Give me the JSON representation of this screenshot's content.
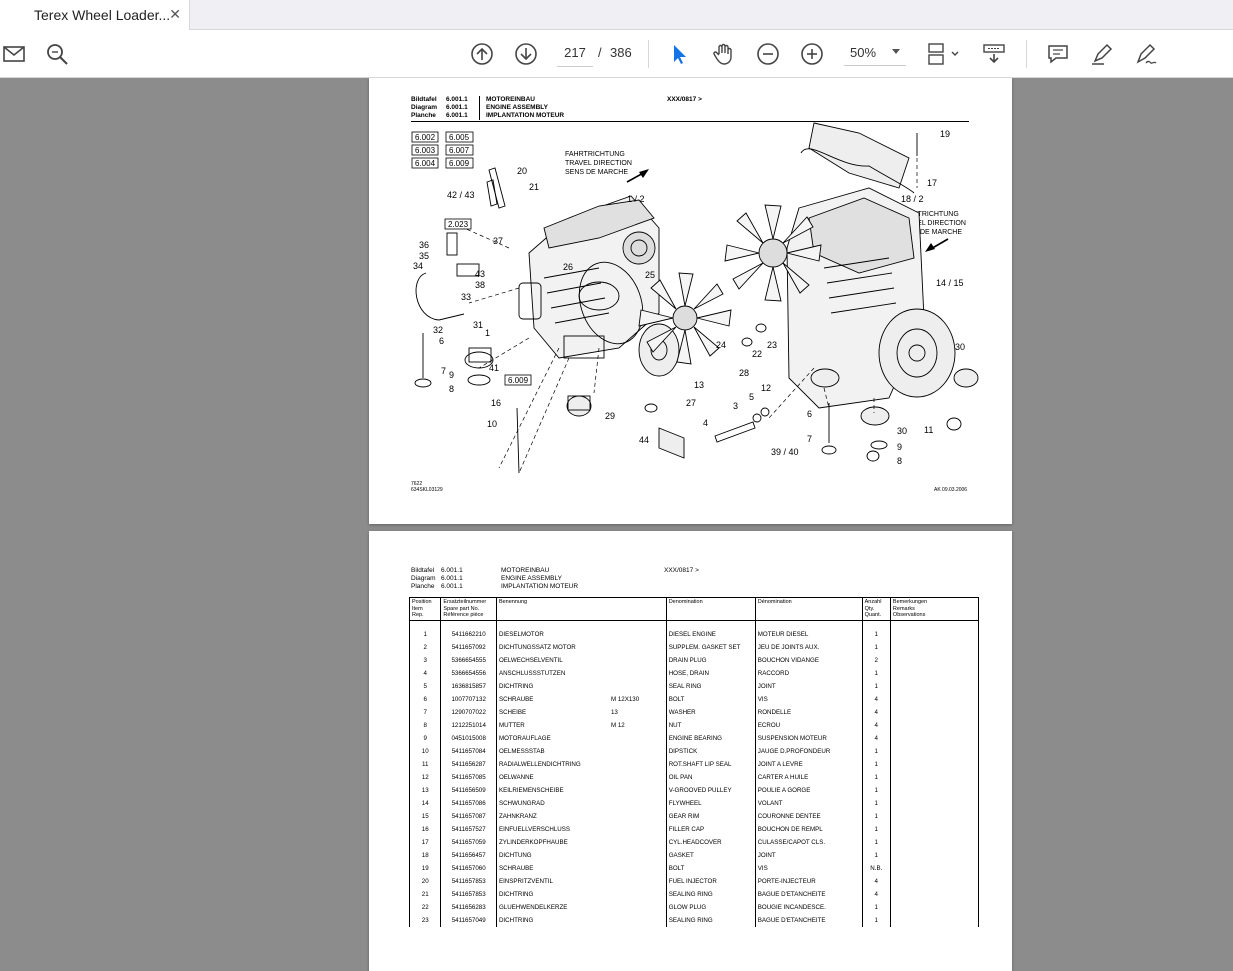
{
  "tab": {
    "title": "Terex Wheel Loader...",
    "close": "✕"
  },
  "toolbar": {
    "page_current": "217",
    "page_separator": "/",
    "page_total": "386",
    "zoom": "50%"
  },
  "page1": {
    "header": {
      "labels": [
        "Bildtafel",
        "Diagram",
        "Planche"
      ],
      "codes": [
        "6.001.1",
        "6.001.1",
        "6.001.1"
      ],
      "titles": [
        "MOTOREINBAU",
        "ENGINE ASSEMBLY",
        "IMPLANTATION MOTEUR"
      ],
      "serial": "XXX/0817 >"
    },
    "refs": [
      "6.002",
      "6.005",
      "6.003",
      "6.007",
      "6.004",
      "6.009"
    ],
    "direction_left": [
      "FAHRTRICHTUNG",
      "TRAVEL DIRECTION",
      "SENS DE MARCHE"
    ],
    "direction_right": [
      "FAHRTRICHTUNG",
      "TRAVEL DIRECTION",
      "SENS DE MARCHE"
    ],
    "callouts_left": [
      "20",
      "21",
      "42 / 43",
      "1 / 2",
      "2.023",
      "37",
      "36",
      "35",
      "34",
      "43",
      "38",
      "26",
      "25",
      "33",
      "31",
      "32",
      "6",
      "1",
      "7",
      "9",
      "8",
      "41",
      "6.009",
      "16",
      "10",
      "29",
      "27",
      "44",
      "24",
      "13"
    ],
    "callouts_right": [
      "19",
      "17",
      "18 / 2",
      "14 / 15",
      "23",
      "22",
      "28",
      "5",
      "12",
      "3",
      "4",
      "30",
      "6",
      "7",
      "39 / 40",
      "30",
      "11",
      "9",
      "8"
    ],
    "footer_left": [
      "7622",
      "634SKL03129"
    ],
    "footer_right": "AK  09.03.2006"
  },
  "page2": {
    "header": {
      "labels": [
        "Bildtafel",
        "Diagram",
        "Planche"
      ],
      "codes": [
        "6.001.1",
        "6.001.1",
        "6.001.1"
      ],
      "titles": [
        "MOTOREINBAU",
        "ENGINE ASSEMBLY",
        "IMPLANTATION MOTEUR"
      ],
      "serial": "XXX/0817 >"
    },
    "columns": {
      "pos": [
        "Position",
        "Item",
        "Rep."
      ],
      "part": [
        "Ersatzteilnummer",
        "Spare part No.",
        "Référence pièce"
      ],
      "benennung": "Benennung",
      "denomination_en": "Denomination",
      "denomination_fr": "Dénomination",
      "qty": [
        "Anzahl",
        "Qty.",
        "Quant."
      ],
      "remarks": [
        "Bemerkungen",
        "Remarks",
        "Observations"
      ]
    },
    "rows": [
      [
        "1",
        "5411662210",
        "DIESELMOTOR",
        "",
        "DIESEL ENGINE",
        "MOTEUR DIESEL",
        "1"
      ],
      [
        "2",
        "5411657092",
        "DICHTUNGSSATZ MOTOR",
        "",
        "SUPPLEM. GASKET SET",
        "JEU DE JOINTS AUX.",
        "1"
      ],
      [
        "3",
        "5366654555",
        "OELWECHSELVENTIL",
        "",
        "DRAIN PLUG",
        "BOUCHON VIDANGE",
        "2"
      ],
      [
        "4",
        "5366654556",
        "ANSCHLUSSSTUTZEN",
        "",
        "HOSE, DRAIN",
        "RACCORD",
        "1"
      ],
      [
        "5",
        "1636815857",
        "DICHTRING",
        "",
        "SEAL RING",
        "JOINT",
        "1"
      ],
      [
        "6",
        "1007707132",
        "SCHRAUBE",
        "M 12X130",
        "BOLT",
        "VIS",
        "4"
      ],
      [
        "7",
        "1290707022",
        "SCHEIBE",
        "13",
        "WASHER",
        "RONDELLE",
        "4"
      ],
      [
        "8",
        "1212251014",
        "MUTTER",
        "M 12",
        "NUT",
        "ECROU",
        "4"
      ],
      [
        "9",
        "0451015008",
        "MOTORAUFLAGE",
        "",
        "ENGINE BEARING",
        "SUSPENSION MOTEUR",
        "4"
      ],
      [
        "10",
        "5411657084",
        "OELMESSSTAB",
        "",
        "DIPSTICK",
        "JAUGE D.PROFONDEUR",
        "1"
      ],
      [
        "11",
        "5411656287",
        "RADIALWELLENDICHTRING",
        "",
        "ROT.SHAFT LIP SEAL",
        "JOINT A LEVRE",
        "1"
      ],
      [
        "12",
        "5411657085",
        "OELWANNE",
        "",
        "OIL PAN",
        " CARTER A HUILE",
        "1"
      ],
      [
        "13",
        "5411656509",
        "KEILRIEMENSCHEIBE",
        "",
        "V-GROOVED PULLEY",
        "POULIE A GORGE",
        "1"
      ],
      [
        "14",
        "5411657086",
        "SCHWUNGRAD",
        "",
        "FLYWHEEL",
        "VOLANT",
        "1"
      ],
      [
        "15",
        "5411657087",
        "ZAHNKRANZ",
        "",
        "GEAR RIM",
        "COURONNE DENTEE",
        "1"
      ],
      [
        "16",
        "5411657527",
        "EINFUELLVERSCHLUSS",
        "",
        "FILLER CAP",
        "BOUCHON DE REMPL",
        "1"
      ],
      [
        "17",
        "5411657059",
        "ZYLINDERKOPFHAUBE",
        "",
        "CYL.HEADCOVER",
        "CULASSE/CAPOT CLS.",
        "1"
      ],
      [
        "18",
        "5411656457",
        "DICHTUNG",
        "",
        "GASKET",
        "JOINT",
        "1"
      ],
      [
        "19",
        "5411657060",
        "SCHRAUBE",
        "",
        "BOLT",
        "VIS",
        "N.B."
      ],
      [
        "20",
        "5411657853",
        "EINSPRITZVENTIL",
        "",
        "FUEL INJECTOR",
        "PORTE-INJECTEUR",
        "4"
      ],
      [
        "21",
        "5411657853",
        "DICHTRING",
        "",
        "SEALING RING",
        "BAGUE D'ETANCHEITE",
        "4"
      ],
      [
        "22",
        "5411656283",
        "GLUEHWENDELKERZE",
        "",
        "GLOW PLUG",
        "BOUGIE INCANDESCE.",
        "1"
      ],
      [
        "23",
        "5411657049",
        "DICHTRING",
        "",
        "SEALING RING",
        "BAGUE D'ETANCHEITE",
        "1"
      ]
    ]
  }
}
